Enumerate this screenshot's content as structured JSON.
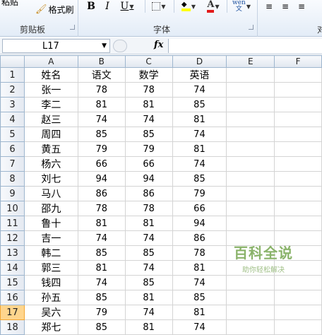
{
  "ribbon": {
    "paste_label": "粘贴",
    "format_painter_label": "格式刷",
    "clipboard_group": "剪贴板",
    "font_group": "字体",
    "align_group_partial": "对",
    "bold": "B",
    "italic": "I",
    "underline": "U",
    "wen": "wén\n文"
  },
  "formula_bar": {
    "name_box": "L17",
    "fx": "fx",
    "formula": ""
  },
  "sheet": {
    "columns": [
      "A",
      "B",
      "C",
      "D",
      "E",
      "F"
    ],
    "header": [
      "姓名",
      "语文",
      "数学",
      "英语"
    ],
    "rows": [
      [
        "张一",
        "78",
        "78",
        "74"
      ],
      [
        "李二",
        "81",
        "81",
        "85"
      ],
      [
        "赵三",
        "74",
        "74",
        "81"
      ],
      [
        "周四",
        "85",
        "85",
        "74"
      ],
      [
        "黄五",
        "79",
        "79",
        "81"
      ],
      [
        "杨六",
        "66",
        "66",
        "74"
      ],
      [
        "刘七",
        "94",
        "94",
        "85"
      ],
      [
        "马八",
        "86",
        "86",
        "79"
      ],
      [
        "邵九",
        "78",
        "78",
        "66"
      ],
      [
        "鲁十",
        "81",
        "81",
        "94"
      ],
      [
        "吉一",
        "74",
        "74",
        "86"
      ],
      [
        "韩二",
        "85",
        "85",
        "78"
      ],
      [
        "郭三",
        "81",
        "74",
        "81"
      ],
      [
        "钱四",
        "74",
        "85",
        "74"
      ],
      [
        "孙五",
        "85",
        "81",
        "85"
      ],
      [
        "吴六",
        "79",
        "74",
        "81"
      ],
      [
        "郑七",
        "85",
        "81",
        "74"
      ]
    ],
    "active_row": "17"
  },
  "watermark": {
    "title": "百科全说",
    "subtitle": "助你轻松解决"
  },
  "colors": {
    "ribbon_bg": "#e3ecf7",
    "header_bg": "#e1e7ef",
    "active_row_header": "#ffd58d",
    "watermark_green": "#8ab36a"
  }
}
